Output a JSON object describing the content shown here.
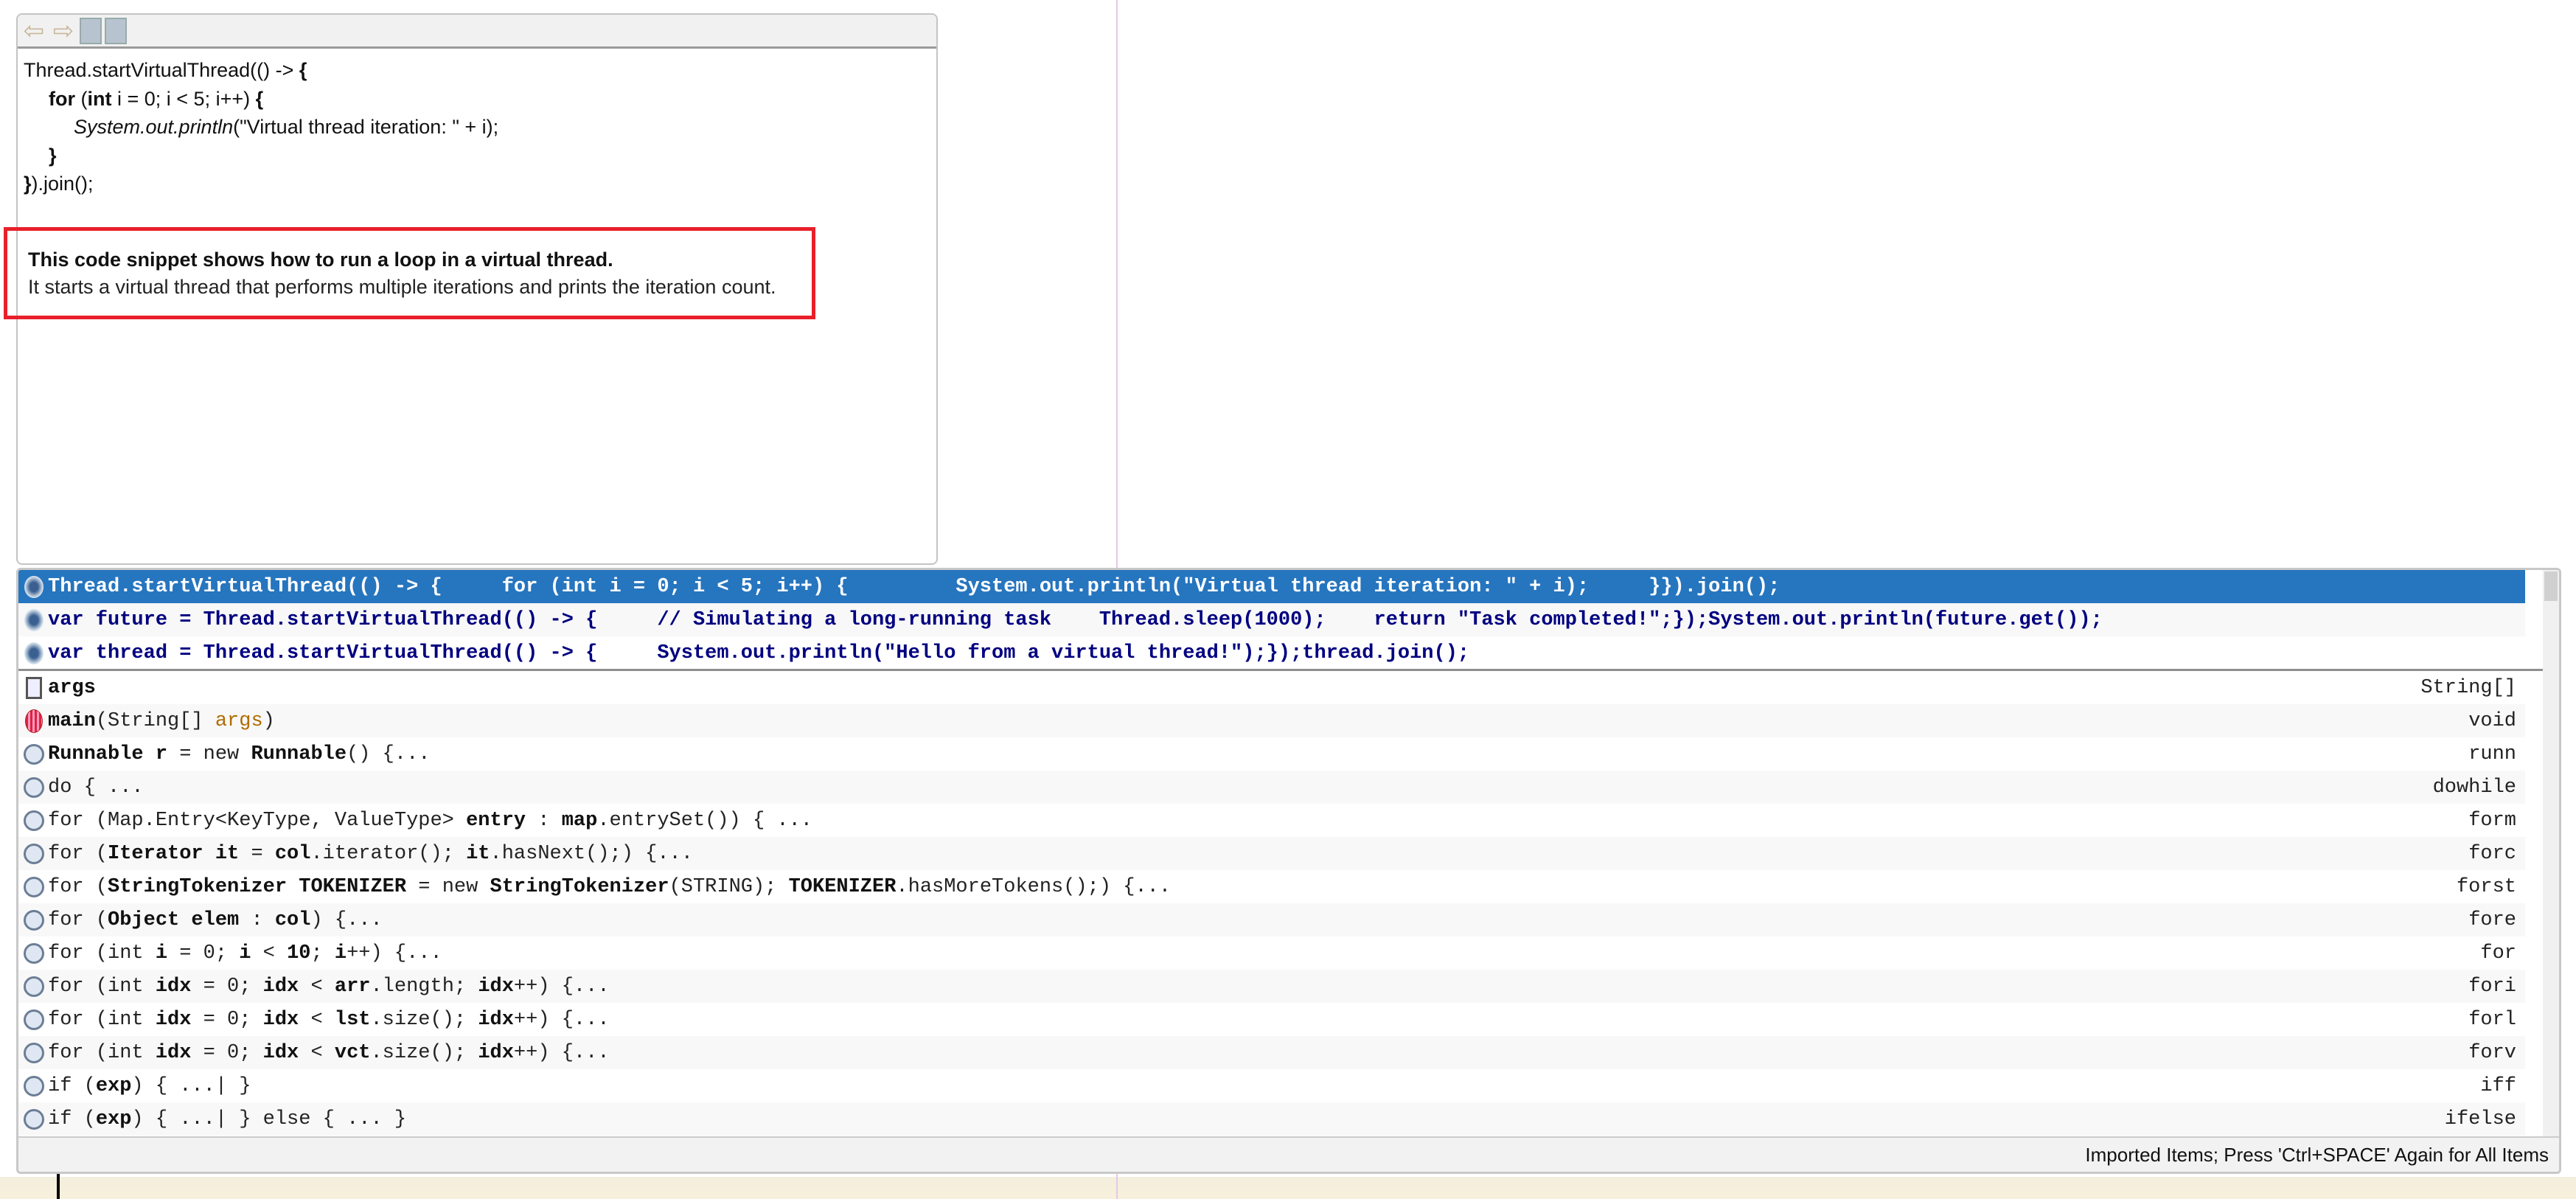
{
  "doc_popup": {
    "toolbar": [
      {
        "name": "back",
        "glyph": "⇦"
      },
      {
        "name": "forward",
        "glyph": "⇨"
      }
    ],
    "code_lines": [
      "Thread.startVirtualThread(() -> {",
      "for (int i = 0; i < 5; i++) {",
      "System.out.println(\"Virtual thread iteration: \" + i);",
      "}",
      "}).join();"
    ],
    "code_parts": {
      "l0a": "Thread.startVirtualThread(() -> ",
      "l0b": "{",
      "l1a": "for",
      "l1b": " (",
      "l1c": "int",
      "l1d": " i = 0; i < 5; i++) ",
      "l1e": "{",
      "l2a": "System.out.println",
      "l2b": "(\"Virtual thread iteration: \" + i);",
      "l3": "}",
      "l4a": "}",
      "l4b": ").join();"
    },
    "description_title": "This code snippet shows how to run a loop in a virtual thread.",
    "description_body": "It starts a virtual thread that performs multiple iterations and prints the iteration count."
  },
  "completion": {
    "suggestions": [
      {
        "text": "Thread.startVirtualThread(() -> {     for (int i = 0; i < 5; i++) {         System.out.println(\"Virtual thread iteration: \" + i);     }}).join();",
        "selected": true
      },
      {
        "text": "var future = Thread.startVirtualThread(() -> {     // Simulating a long-running task    Thread.sleep(1000);    return \"Task completed!\";});System.out.println(future.get());"
      },
      {
        "text": "var thread = Thread.startVirtualThread(() -> {     System.out.println(\"Hello from a virtual thread!\");});thread.join();"
      }
    ],
    "items": [
      {
        "icon": "field",
        "segs": [
          [
            "args",
            "b"
          ]
        ],
        "right": "String[]"
      },
      {
        "icon": "method",
        "segs": [
          [
            "main",
            "b"
          ],
          [
            "(String[] ",
            "n"
          ],
          [
            "args",
            "o"
          ],
          [
            ")",
            "n"
          ]
        ],
        "right": "void"
      },
      {
        "icon": "template",
        "segs": [
          [
            "Runnable r",
            "b"
          ],
          [
            " = new ",
            "n"
          ],
          [
            "Runnable",
            "b"
          ],
          [
            "() {...",
            "n"
          ]
        ],
        "right": "runn"
      },
      {
        "icon": "template",
        "segs": [
          [
            "do { ...",
            "n"
          ]
        ],
        "right": "dowhile"
      },
      {
        "icon": "template",
        "segs": [
          [
            "for (Map.Entry<KeyType, ValueType> ",
            "n"
          ],
          [
            "entry",
            "b"
          ],
          [
            " : ",
            "n"
          ],
          [
            "map",
            "b"
          ],
          [
            ".entrySet()) { ...",
            "n"
          ]
        ],
        "right": "form"
      },
      {
        "icon": "template",
        "segs": [
          [
            "for (",
            "n"
          ],
          [
            "Iterator it",
            "b"
          ],
          [
            " = ",
            "n"
          ],
          [
            "col",
            "b"
          ],
          [
            ".iterator(); ",
            "n"
          ],
          [
            "it",
            "b"
          ],
          [
            ".hasNext();) {...",
            "n"
          ]
        ],
        "right": "forc"
      },
      {
        "icon": "template",
        "segs": [
          [
            "for (",
            "n"
          ],
          [
            "StringTokenizer TOKENIZER",
            "b"
          ],
          [
            " = new ",
            "n"
          ],
          [
            "StringTokenizer",
            "b"
          ],
          [
            "(STRING); ",
            "n"
          ],
          [
            "TOKENIZER",
            "b"
          ],
          [
            ".hasMoreTokens();) {...",
            "n"
          ]
        ],
        "right": "forst"
      },
      {
        "icon": "template",
        "segs": [
          [
            "for (",
            "n"
          ],
          [
            "Object elem",
            "b"
          ],
          [
            " : ",
            "n"
          ],
          [
            "col",
            "b"
          ],
          [
            ") {...",
            "n"
          ]
        ],
        "right": "fore"
      },
      {
        "icon": "template",
        "segs": [
          [
            "for (int ",
            "n"
          ],
          [
            "i",
            "b"
          ],
          [
            " = 0; ",
            "n"
          ],
          [
            "i",
            "b"
          ],
          [
            " < ",
            "n"
          ],
          [
            "10",
            "b"
          ],
          [
            "; ",
            "n"
          ],
          [
            "i",
            "b"
          ],
          [
            "++) {...",
            "n"
          ]
        ],
        "right": "for"
      },
      {
        "icon": "template",
        "segs": [
          [
            "for (int ",
            "n"
          ],
          [
            "idx",
            "b"
          ],
          [
            " = 0; ",
            "n"
          ],
          [
            "idx",
            "b"
          ],
          [
            " < ",
            "n"
          ],
          [
            "arr",
            "b"
          ],
          [
            ".length; ",
            "n"
          ],
          [
            "idx",
            "b"
          ],
          [
            "++) {...",
            "n"
          ]
        ],
        "right": "fori"
      },
      {
        "icon": "template",
        "segs": [
          [
            "for (int ",
            "n"
          ],
          [
            "idx",
            "b"
          ],
          [
            " = 0; ",
            "n"
          ],
          [
            "idx",
            "b"
          ],
          [
            " < ",
            "n"
          ],
          [
            "lst",
            "b"
          ],
          [
            ".size(); ",
            "n"
          ],
          [
            "idx",
            "b"
          ],
          [
            "++) {...",
            "n"
          ]
        ],
        "right": "forl"
      },
      {
        "icon": "template",
        "segs": [
          [
            "for (int ",
            "n"
          ],
          [
            "idx",
            "b"
          ],
          [
            " = 0; ",
            "n"
          ],
          [
            "idx",
            "b"
          ],
          [
            " < ",
            "n"
          ],
          [
            "vct",
            "b"
          ],
          [
            ".size(); ",
            "n"
          ],
          [
            "idx",
            "b"
          ],
          [
            "++) {...",
            "n"
          ]
        ],
        "right": "forv"
      },
      {
        "icon": "template",
        "segs": [
          [
            "if (",
            "n"
          ],
          [
            "exp",
            "b"
          ],
          [
            ") { ...| }",
            "n"
          ]
        ],
        "right": "iff"
      },
      {
        "icon": "template",
        "segs": [
          [
            "if (",
            "n"
          ],
          [
            "exp",
            "b"
          ],
          [
            ") { ...| } else { ... }",
            "n"
          ]
        ],
        "right": "ifelse"
      }
    ],
    "footer": "Imported Items; Press 'Ctrl+SPACE' Again for All Items",
    "colors": {
      "selection": "#2675bf",
      "suggestion_text": "#000080",
      "red_box": "#e8202a"
    }
  }
}
